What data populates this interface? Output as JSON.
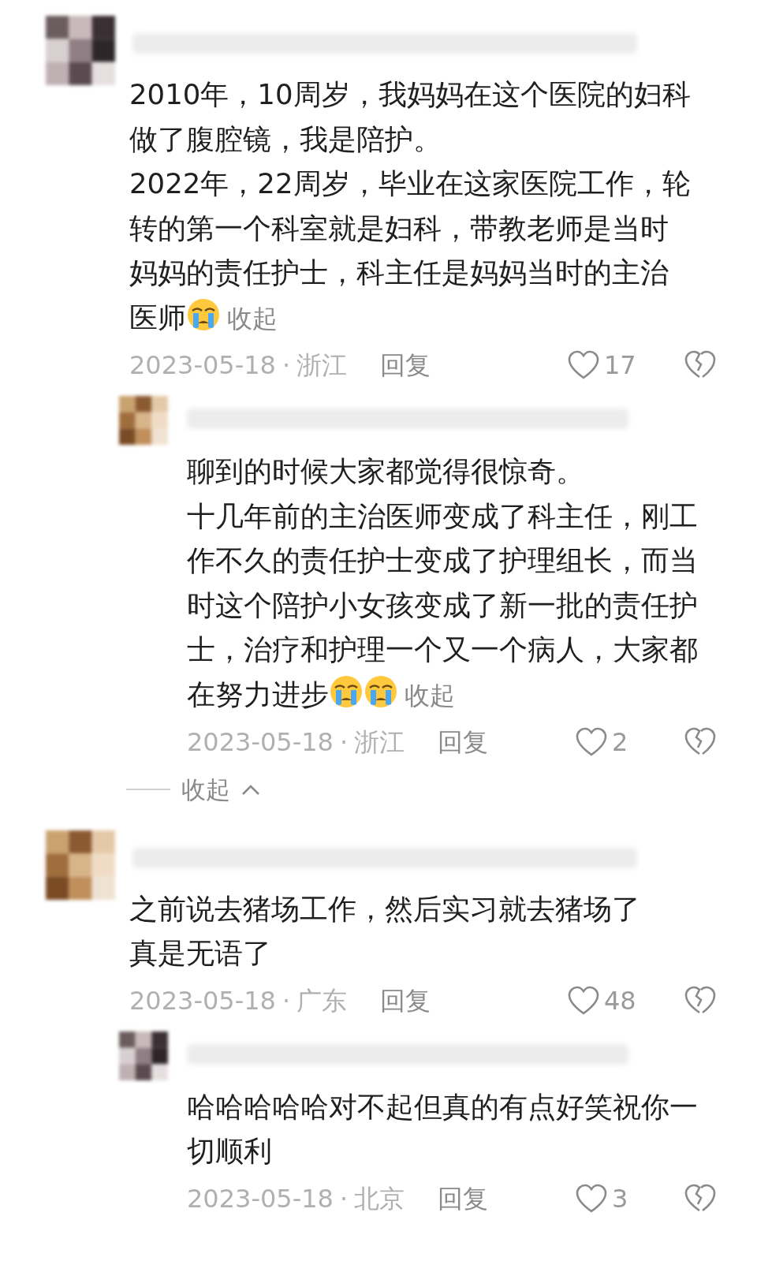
{
  "comments": [
    {
      "paragraphs": [
        "2010年，10周岁，我妈妈在这个医院的妇科做了腹腔镜，我是陪护。",
        "2022年，22周岁，毕业在这家医院工作，轮转的第一个科室就是妇科，带教老师是当时妈妈的责任护士，科主任是妈妈当时的主治医师"
      ],
      "emoji": [
        {
          "kind": "crying"
        }
      ],
      "collapse": "收起",
      "date": "2023-05-18",
      "separator": "·",
      "region": "浙江",
      "reply": "回复",
      "likes": "17",
      "children": [
        {
          "paragraphs": [
            "聊到的时候大家都觉得很惊奇。",
            "十几年前的主治医师变成了科主任，刚工作不久的责任护士变成了护理组长，而当时这个陪护小女孩变成了新一批的责任护士，治疗和护理一个又一个病人，大家都在努力进步"
          ],
          "emoji": [
            {
              "kind": "crying"
            },
            {
              "kind": "crying"
            }
          ],
          "collapse": "收起",
          "date": "2023-05-18",
          "separator": "·",
          "region": "浙江",
          "reply": "回复",
          "likes": "2"
        }
      ],
      "thread_toggle": "收起"
    },
    {
      "paragraphs": [
        "之前说去猪场工作，然后实习就去猪场了",
        "真是无语了"
      ],
      "date": "2023-05-18",
      "separator": "·",
      "region": "广东",
      "reply": "回复",
      "likes": "48",
      "children": [
        {
          "paragraphs": [
            "哈哈哈哈哈对不起但真的有点好笑祝你一切顺利"
          ],
          "date": "2023-05-18",
          "separator": "·",
          "region": "北京",
          "reply": "回复",
          "likes": "3"
        }
      ]
    }
  ]
}
